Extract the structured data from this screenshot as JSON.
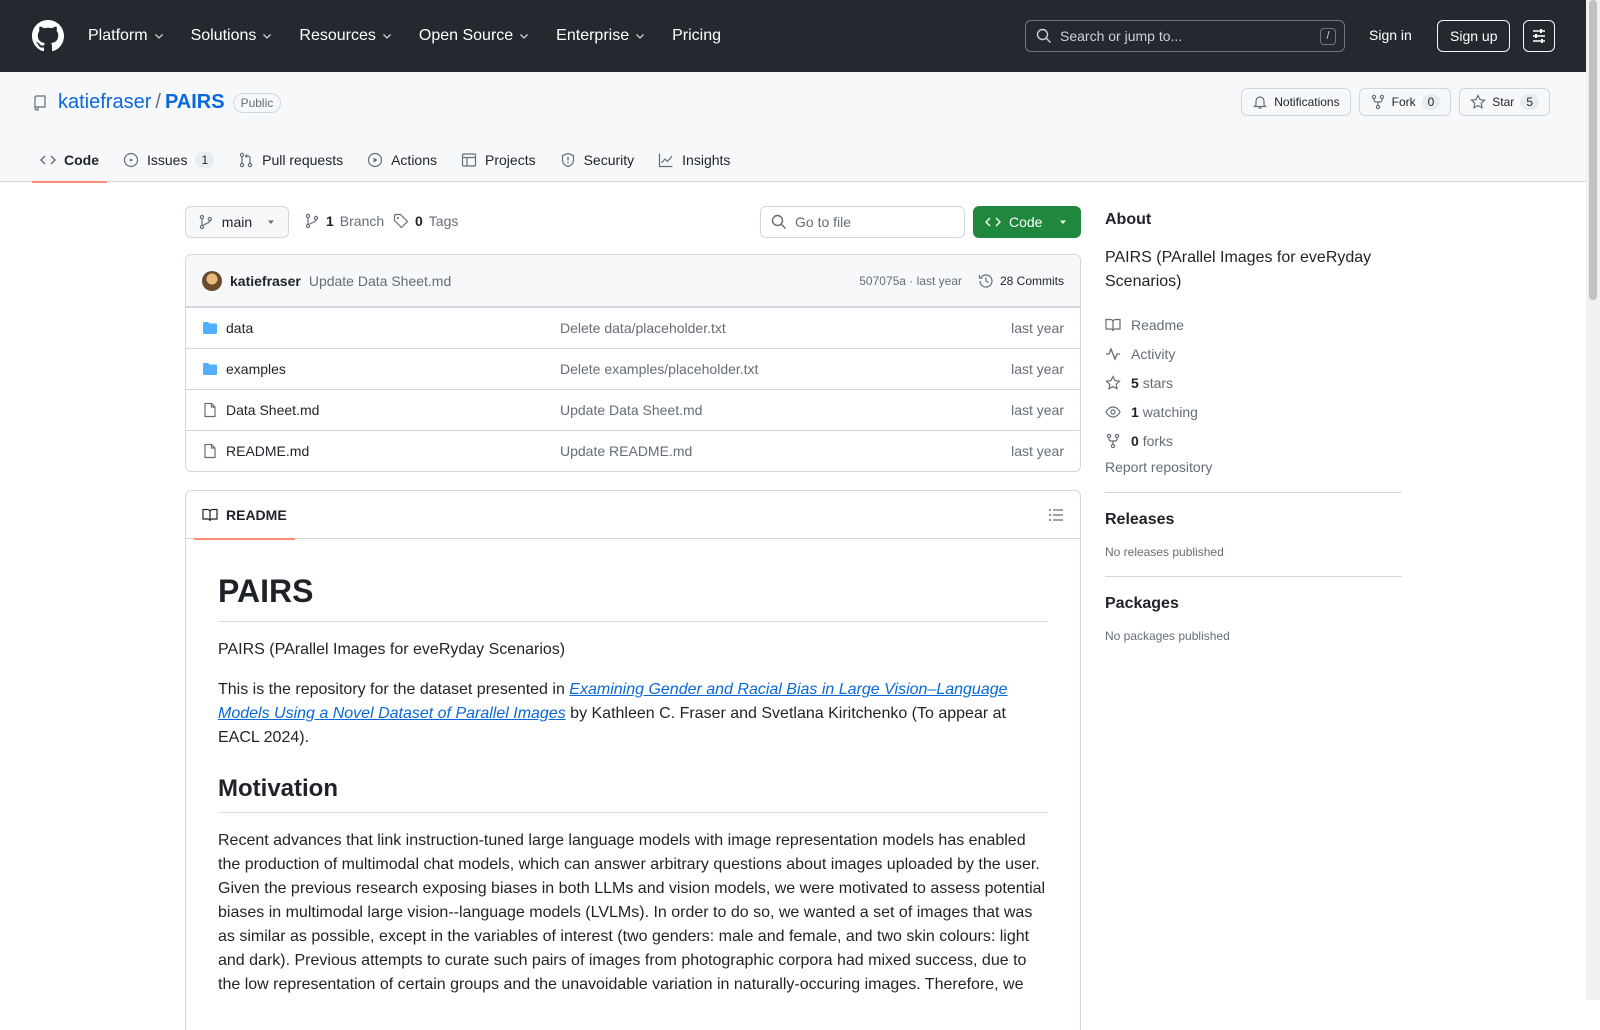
{
  "nav": {
    "platform": "Platform",
    "solutions": "Solutions",
    "resources": "Resources",
    "open_source": "Open Source",
    "enterprise": "Enterprise",
    "pricing": "Pricing",
    "search_placeholder": "Search or jump to...",
    "slash": "/",
    "sign_in": "Sign in",
    "sign_up": "Sign up"
  },
  "repo": {
    "owner": "katiefraser",
    "separator": "/",
    "name": "PAIRS",
    "visibility": "Public",
    "notifications": "Notifications",
    "fork": "Fork",
    "fork_count": "0",
    "star": "Star",
    "star_count": "5"
  },
  "tabs": [
    {
      "label": "Code"
    },
    {
      "label": "Issues",
      "count": "1"
    },
    {
      "label": "Pull requests"
    },
    {
      "label": "Actions"
    },
    {
      "label": "Projects"
    },
    {
      "label": "Security"
    },
    {
      "label": "Insights"
    }
  ],
  "toolbar": {
    "branch": "main",
    "branch_count": "1",
    "branch_label": "Branch",
    "tag_count": "0",
    "tag_label": "Tags",
    "go_to_file": "Go to file",
    "code": "Code"
  },
  "commit": {
    "author": "katiefraser",
    "message": "Update Data Sheet.md",
    "hash_time": "507075a · last year",
    "commits": "28 Commits"
  },
  "files": [
    {
      "name": "data",
      "type": "folder",
      "message": "Delete data/placeholder.txt",
      "time": "last year"
    },
    {
      "name": "examples",
      "type": "folder",
      "message": "Delete examples/placeholder.txt",
      "time": "last year"
    },
    {
      "name": "Data Sheet.md",
      "type": "file",
      "message": "Update Data Sheet.md",
      "time": "last year"
    },
    {
      "name": "README.md",
      "type": "file",
      "message": "Update README.md",
      "time": "last year"
    }
  ],
  "readme": {
    "tab": "README",
    "title": "PAIRS",
    "subtitle": "PAIRS (PArallel Images for eveRyday Scenarios)",
    "intro_before": "This is the repository for the dataset presented in ",
    "intro_link": "Examining Gender and Racial Bias in Large Vision–Language Models Using a Novel Dataset of Parallel Images",
    "intro_after": " by Kathleen C. Fraser and Svetlana Kiritchenko (To appear at EACL 2024).",
    "motivation_heading": "Motivation",
    "motivation_text": "Recent advances that link instruction-tuned large language models with image representation models has enabled the production of multimodal chat models, which can answer arbitrary questions about images uploaded by the user. Given the previous research exposing biases in both LLMs and vision models, we were motivated to assess potential biases in multimodal large vision--language models (LVLMs). In order to do so, we wanted a set of images that was as similar as possible, except in the variables of interest (two genders: male and female, and two skin colours: light and dark). Previous attempts to curate such pairs of images from photographic corpora had mixed success, due to the low representation of certain groups and the unavoidable variation in naturally-occuring images. Therefore, we"
  },
  "about": {
    "heading": "About",
    "description": "PAIRS (PArallel Images for eveRyday Scenarios)",
    "readme": "Readme",
    "activity": "Activity",
    "stars_count": "5",
    "stars_label": "stars",
    "watching_count": "1",
    "watching_label": "watching",
    "forks_count": "0",
    "forks_label": "forks",
    "report": "Report repository"
  },
  "releases": {
    "heading": "Releases",
    "none": "No releases published"
  },
  "packages": {
    "heading": "Packages",
    "none": "No packages published"
  }
}
